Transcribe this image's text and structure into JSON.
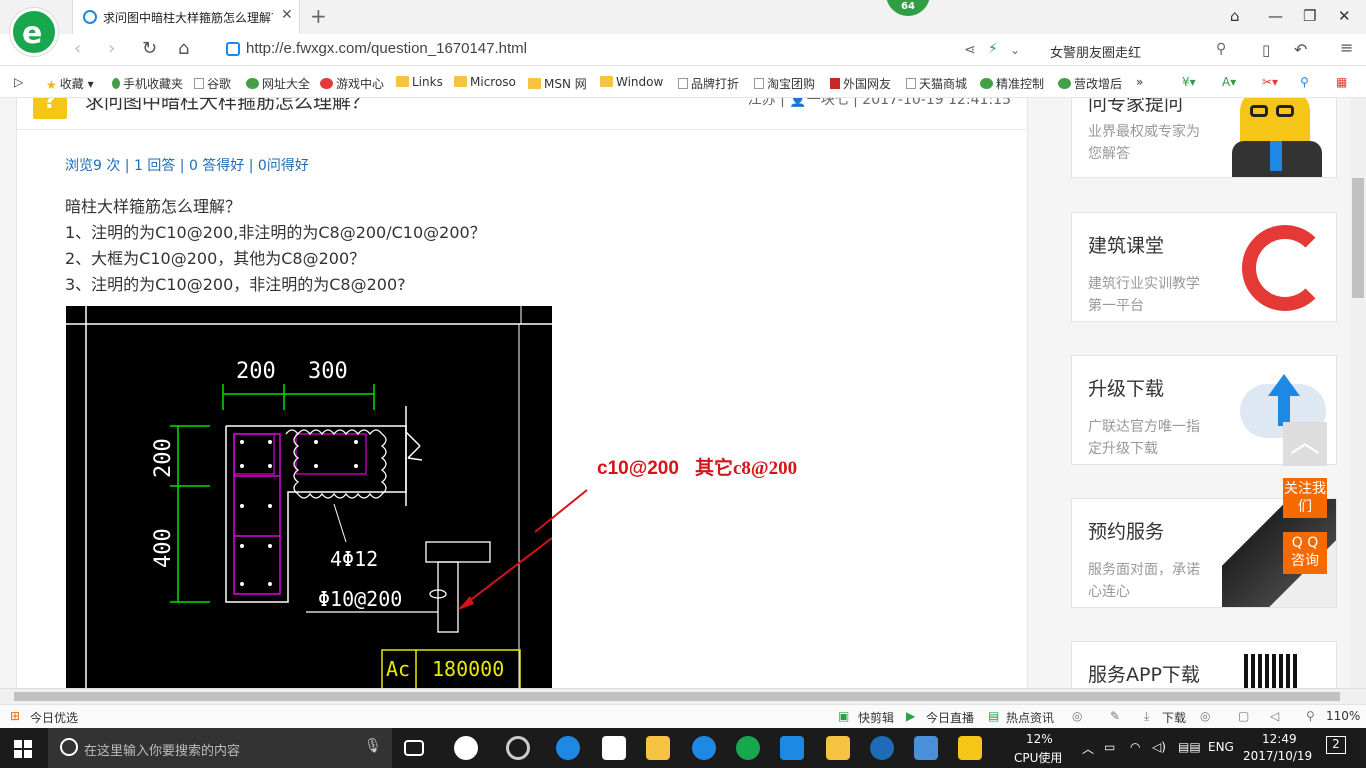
{
  "browser": {
    "tab_title": "求问图中暗柱大样箍筋怎么理解？",
    "badge": "64",
    "url": "http://e.fwxgx.com/question_1670147.html",
    "search_text": "女警朋友圈走红"
  },
  "bookmarks": [
    "收藏",
    "手机收藏夹",
    "谷歌",
    "网址大全",
    "游戏中心",
    "Links",
    "Microso",
    "MSN 网",
    "Window",
    "品牌打折",
    "淘宝团购",
    "外国网友",
    "天猫商城",
    "精准控制",
    "营改增后"
  ],
  "question": {
    "title": "求问图中暗柱大样箍筋怎么理解？",
    "meta": "江苏 | 👤一块七 | 2017-10-19 12:41:15",
    "stats": "浏览9 次 | 1 回答 | 0 答得好 | 0问得好",
    "lines": [
      "暗柱大样箍筋怎么理解？",
      "1、注明的为C10@200,非注明的为C8@200/C10@200？",
      "2、大框为C10@200，其他为C8@200？",
      "3、注明的为C10@200，非注明的为C8@200?"
    ]
  },
  "drawing": {
    "dim_200": "200",
    "dim_300": "300",
    "dim_200v": "200",
    "dim_400v": "400",
    "bars": "4Φ12",
    "stirrup": "Φ10@200",
    "ac": "Ac",
    "area": "180000",
    "annot1": "c10@200",
    "annot2": "其它c8@200"
  },
  "sidebar": [
    {
      "title": "问专家提问",
      "sub": "业界最权威专家为您解答"
    },
    {
      "title": "建筑课堂",
      "sub": "建筑行业实训教学第一平台"
    },
    {
      "title": "升级下载",
      "sub": "广联达官方唯一指定升级下载"
    },
    {
      "title": "预约服务",
      "sub": "服务面对面，承诺心连心"
    },
    {
      "title": "服务APP下载",
      "sub": ""
    }
  ],
  "float_buttons": {
    "follow": "关注我们",
    "qq": "Q Q 咨询"
  },
  "statusbar": {
    "left": "今日优选",
    "kuaijianji": "快剪辑",
    "live": "今日直播",
    "news": "热点资讯",
    "download": "下载",
    "zoom": "110%"
  },
  "taskbar": {
    "search_placeholder": "在这里输入你要搜索的内容",
    "cpu_pct": "12%",
    "cpu_label": "CPU使用",
    "lang": "ENG",
    "time": "12:49",
    "date": "2017/10/19",
    "notif": "2"
  },
  "colors": {
    "accent_green": "#19a74e",
    "link_blue": "#1e6bb8",
    "annot_red": "#d4141a",
    "orange": "#f56a00"
  }
}
